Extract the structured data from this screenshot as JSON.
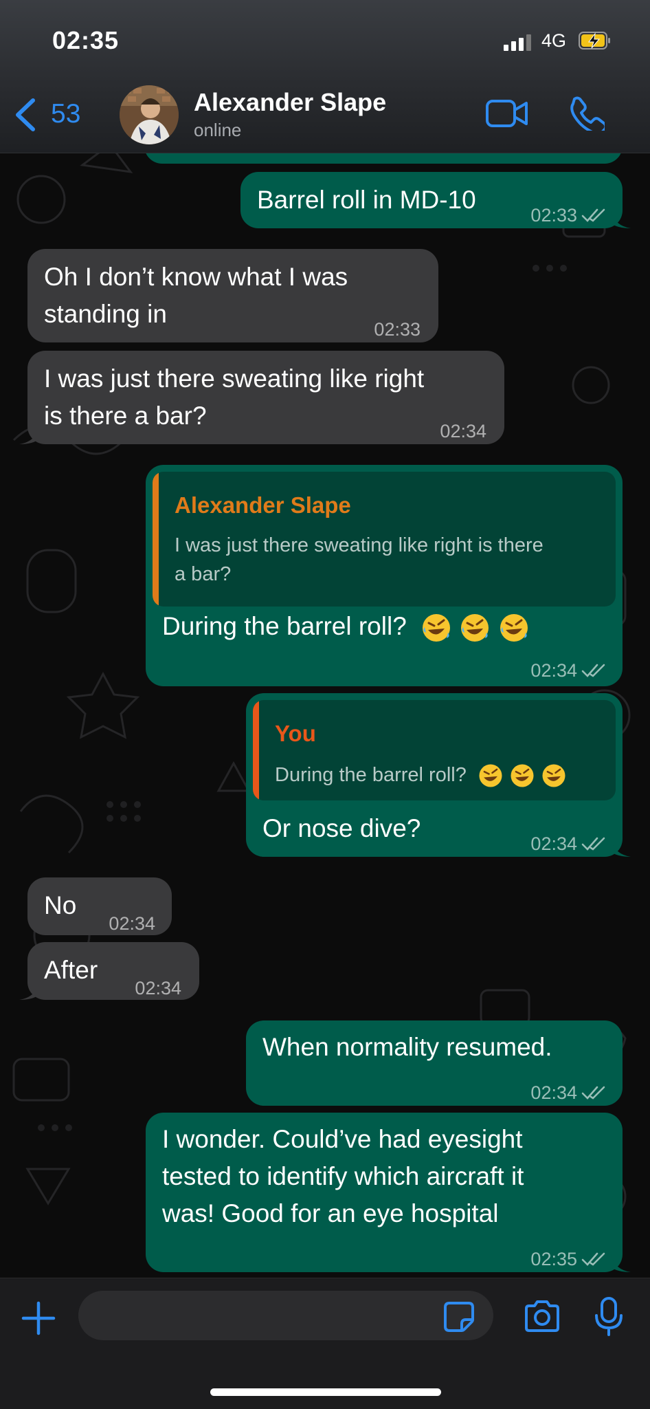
{
  "status_bar": {
    "time": "02:35",
    "network": "4G"
  },
  "header": {
    "back_count": "53",
    "contact_name": "Alexander Slape",
    "contact_status": "online",
    "icons": [
      "chevron-left-icon",
      "video-call-icon",
      "phone-icon"
    ]
  },
  "messages": [
    {
      "direction": "out",
      "text": "Barrel roll in MD-10",
      "time": "02:33",
      "status": "read"
    },
    {
      "direction": "in",
      "lines": [
        "Oh I don’t know what I was",
        "standing in"
      ],
      "time": "02:33"
    },
    {
      "direction": "in",
      "lines": [
        "I was just there sweating like right",
        "is there a bar?"
      ],
      "time": "02:34"
    },
    {
      "direction": "out",
      "reply_to": {
        "author": "Alexander Slape",
        "lines": [
          "I was just there sweating like right is there",
          "a bar?"
        ]
      },
      "text": "During the barrel roll? 🤣🤣🤣",
      "text_plain": "During the barrel roll?",
      "time": "02:34",
      "status": "read"
    },
    {
      "direction": "out",
      "reply_to": {
        "author": "You",
        "text": "During the barrel roll? 🤣🤣🤣",
        "text_plain": "During the barrel roll?"
      },
      "text": "Or nose dive?",
      "time": "02:34",
      "status": "read"
    },
    {
      "direction": "in",
      "text": "No",
      "time": "02:34"
    },
    {
      "direction": "in",
      "text": "After",
      "time": "02:34"
    },
    {
      "direction": "out",
      "text": "When normality resumed.",
      "time": "02:34",
      "status": "read"
    },
    {
      "direction": "out",
      "lines": [
        "I wonder. Could’ve had eyesight",
        "tested to identify which aircraft it",
        "was! Good for an eye hospital"
      ],
      "time": "02:35",
      "status": "read"
    }
  ],
  "composer": {
    "placeholder": ""
  },
  "colors": {
    "accent_blue": "#2f8bf0",
    "outgoing_bubble": "#005c4b",
    "incoming_bubble": "#3a3a3c",
    "quote_author_contact": "#e07b1a",
    "quote_author_you": "#e8571a"
  }
}
